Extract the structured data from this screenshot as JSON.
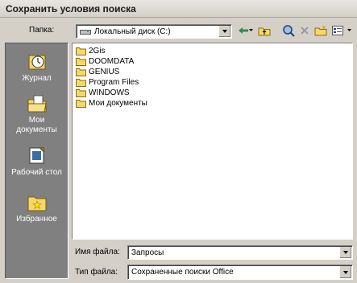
{
  "window": {
    "title": "Сохранить условия поиска"
  },
  "lookin": {
    "label": "Папка:",
    "value": "Локальный диск (C:)"
  },
  "places": [
    {
      "label": "Журнал",
      "icon": "history-icon"
    },
    {
      "label": "Мои документы",
      "icon": "my-documents-icon"
    },
    {
      "label": "Рабочий стол",
      "icon": "desktop-icon"
    },
    {
      "label": "Избранное",
      "icon": "favorites-icon"
    }
  ],
  "files": [
    {
      "name": "2Gis"
    },
    {
      "name": "DOOMDATA"
    },
    {
      "name": "GENIUS"
    },
    {
      "name": "Program Files"
    },
    {
      "name": "WINDOWS"
    },
    {
      "name": "Мои документы"
    }
  ],
  "filename": {
    "label": "Имя файла:",
    "value": "Запросы"
  },
  "filetype": {
    "label": "Тип файла:",
    "value": "Сохраненные поиски Office"
  },
  "colors": {
    "panel_bg": "#808080",
    "face": "#d4d0c8",
    "folder": "#f5d76e"
  }
}
